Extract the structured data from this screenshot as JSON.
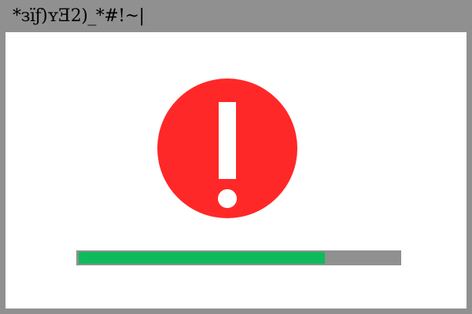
{
  "window": {
    "title": "*зїƒ)ʏƎ2)_*#!~|"
  },
  "alert": {
    "icon": "exclamation-circle-icon",
    "color": "#ff2828",
    "glyph_color": "#ffffff"
  },
  "progress": {
    "fraction": 0.77,
    "track_color": "#8f908f",
    "fill_color": "#0fba5c"
  }
}
